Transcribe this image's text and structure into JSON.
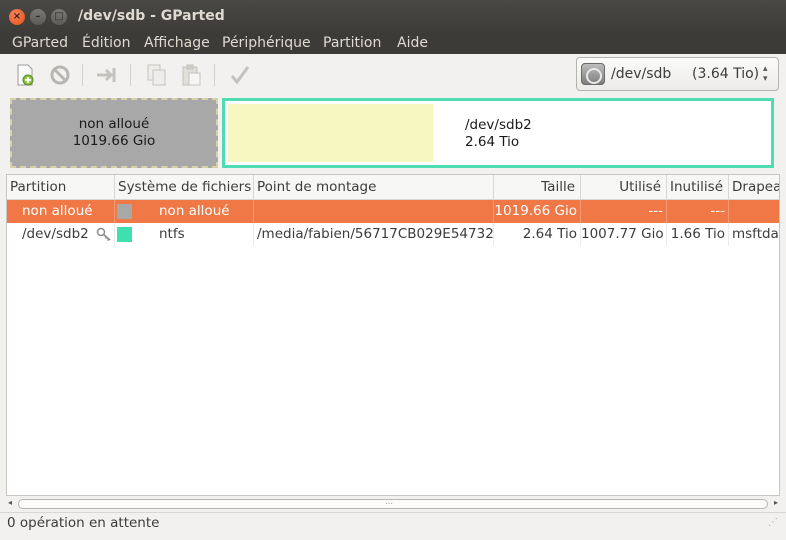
{
  "window": {
    "title": "/dev/sdb - GParted",
    "close": "×",
    "minimize": "–",
    "maximize": "□"
  },
  "menu": [
    "GParted",
    "Édition",
    "Affichage",
    "Périphérique",
    "Partition",
    "Aide"
  ],
  "toolbar": {
    "icons": [
      "new-icon",
      "delete-icon",
      "resize-move-icon",
      "copy-icon",
      "paste-icon",
      "apply-icon"
    ]
  },
  "device_selector": {
    "name": "/dev/sdb",
    "size": "(3.64 Tio)",
    "arrows": "▴▾"
  },
  "graph": {
    "unallocated": {
      "label": "non alloué",
      "size": "1019.66 Gio"
    },
    "sdb2": {
      "label": "/dev/sdb2",
      "size": "2.64 Tio",
      "used_fraction": 0.38
    }
  },
  "table": {
    "headers": [
      "Partition",
      "Système de fichiers",
      "Point de montage",
      "Taille",
      "Utilisé",
      "Inutilisé",
      "Drapeaux"
    ],
    "rows": [
      {
        "partition": "non alloué",
        "fs_color": "#a8a8a8",
        "filesystem": "non alloué",
        "mount": "",
        "size": "1019.66 Gio",
        "used": "---",
        "unused": "---",
        "flags": "",
        "selected": true
      },
      {
        "partition": "/dev/sdb2",
        "fs_color": "#3fe0b0",
        "filesystem": "ntfs",
        "mount": "/media/fabien/56717CB029E54732",
        "size": "2.64 Tio",
        "used": "1007.77 Gio",
        "unused": "1.66 Tio",
        "flags": "msftdata",
        "selected": false,
        "mounted_key_icon": "key-icon"
      }
    ]
  },
  "status": {
    "text": "0 opération en attente"
  },
  "colors": {
    "titlebar": "#3c3b37",
    "selection": "#f07746",
    "ntfs": "#3fe0b0",
    "unallocated": "#a8a8a8"
  }
}
